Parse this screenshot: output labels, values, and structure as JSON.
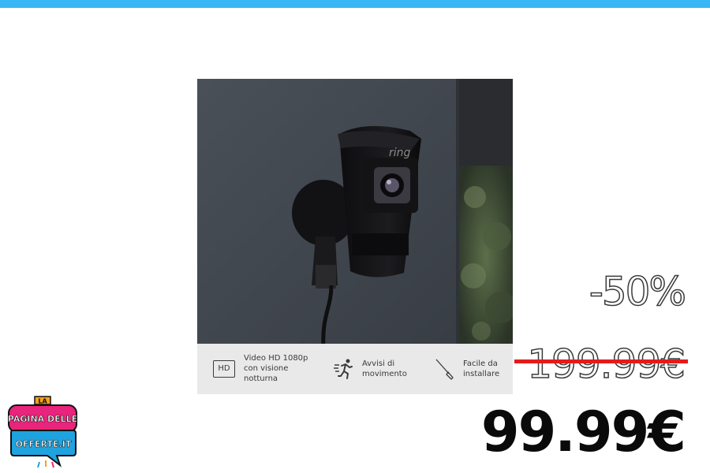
{
  "accent": "#39b6f5",
  "product": {
    "brand_mark": "ring",
    "features": [
      {
        "icon": "hd-icon",
        "icon_text": "HD",
        "text": "Video HD 1080p\ncon visione\nnotturna"
      },
      {
        "icon": "running-person-icon",
        "text": "Avvisi di\nmovimento"
      },
      {
        "icon": "screwdriver-icon",
        "text": "Facile da\ninstallare"
      }
    ]
  },
  "price": {
    "discount": "-50%",
    "old": "199.99€",
    "new": "99.99€",
    "strike_color": "#e41b1b"
  },
  "logo": {
    "top": "LA",
    "line1": "PAGINA DELLE",
    "line2": "OFFERTE.IT"
  }
}
